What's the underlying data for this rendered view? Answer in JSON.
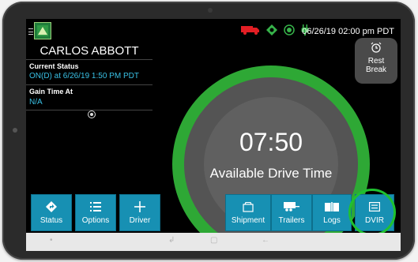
{
  "status_bar": {
    "datetime": "06/26/19 02:00 pm PDT",
    "colors": {
      "truck": "#e31e24",
      "gps": "#37b34a",
      "wifi": "#37b34a",
      "plug": "#37b34a"
    }
  },
  "driver": {
    "name": "CARLOS ABBOTT",
    "current_status_label": "Current Status",
    "current_status_value": "ON(D) at 6/26/19 1:50 PM PDT",
    "gain_time_label": "Gain Time At",
    "gain_time_value": "N/A"
  },
  "gauge": {
    "time": "07:50",
    "label": "Available Drive Time",
    "colors": {
      "ring": "#2ea835",
      "face": "#545454"
    }
  },
  "rest_break": {
    "line1": "Rest",
    "line2": "Break"
  },
  "toolbar": {
    "status": "Status",
    "options": "Options",
    "driver": "Driver",
    "shipment": "Shipment",
    "trailers": "Trailers",
    "logs": "Logs",
    "dvir": "DVIR",
    "colors": {
      "button": "#1790b3",
      "highlight_ring": "#1fc12f"
    }
  },
  "icons": {
    "status": "diamond-arrow-icon",
    "options": "list-icon",
    "driver": "plus-icon",
    "shipment": "package-icon",
    "trailers": "trailer-icon",
    "logs": "book-icon",
    "dvir": "inspection-report-icon",
    "rest_break": "alarm-clock-icon"
  }
}
